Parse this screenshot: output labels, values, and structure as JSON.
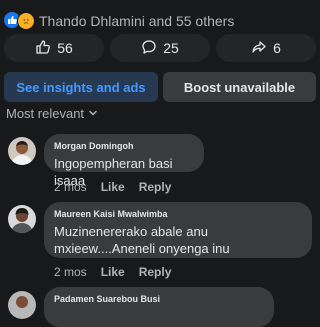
{
  "reactions": {
    "summary": "Thando Dhlamini and 55 others",
    "icons": [
      "like-icon",
      "sad-icon"
    ]
  },
  "stats": {
    "likes": "56",
    "comments": "25",
    "shares": "6"
  },
  "actions": {
    "insights_label": "See insights and ads",
    "boost_label": "Boost unavailable"
  },
  "sort": {
    "label": "Most relevant"
  },
  "comments": [
    {
      "name": "Morgan Domingoh",
      "text": "Ingopempheran basi isaaa",
      "time": "2 mos",
      "like": "Like",
      "reply": "Reply"
    },
    {
      "name": "Maureen Kaisi Mwalwimba",
      "text": "Muzinenererako abale anu mxieew....Aneneli onyenga inu",
      "time": "2 mos",
      "like": "Like",
      "reply": "Reply"
    },
    {
      "name": "Padamen Suarebou Busi"
    }
  ],
  "colors": {
    "background": "#18191a",
    "bubble": "#3a3b3c",
    "accent": "#4599ff",
    "like_reaction": "#1877f2",
    "sad_reaction": "#f7b125"
  }
}
